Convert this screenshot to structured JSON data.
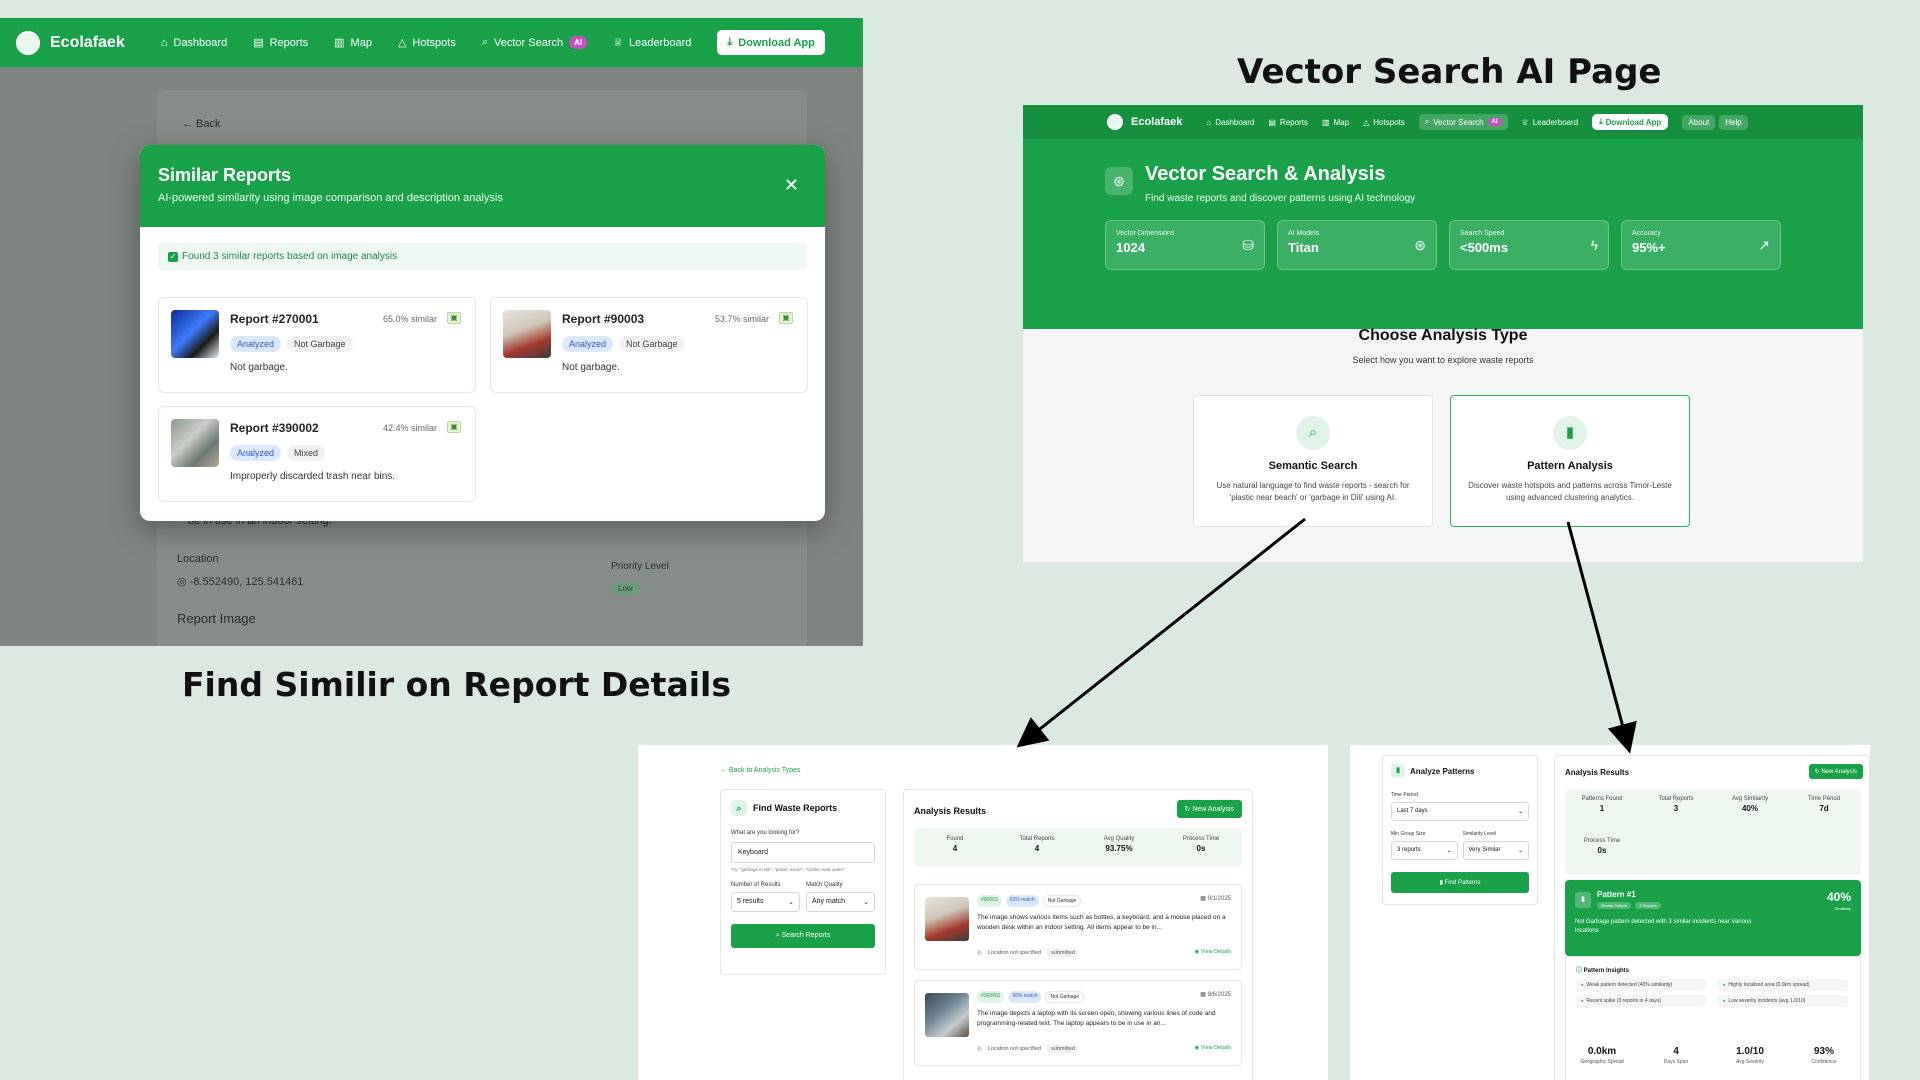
{
  "headings": {
    "vector": "Vector Search AI Page",
    "similar": "Find Similir on Report Details"
  },
  "colors": {
    "brand": "#19a14a",
    "ai_badge": "#c850c0",
    "background": "#dce9e1"
  },
  "p1": {
    "brand": "Ecolafaek",
    "nav": [
      "Dashboard",
      "Reports",
      "Map",
      "Hotspots",
      "Vector Search",
      "Leaderboard"
    ],
    "ai": "AI",
    "download": "Download App",
    "back": "← Back",
    "bg_text": "be in use in an indoor setting.",
    "location_label": "Location",
    "location_value": "-8.552490, 125.541461",
    "priority_label": "Priority Level",
    "priority_value": "Low",
    "report_image": "Report Image",
    "modal": {
      "title": "Similar Reports",
      "subtitle": "AI-powered similarity using image comparison and description analysis",
      "close": "✕",
      "found": "Found 3 similar reports based on image analysis",
      "reports": [
        {
          "title": "Report #270001",
          "sim": "65.0% similar",
          "status": "Analyzed",
          "type": "Not Garbage",
          "desc": "Not garbage."
        },
        {
          "title": "Report #90003",
          "sim": "53.7% similar",
          "status": "Analyzed",
          "type": "Not Garbage",
          "desc": "Not garbage."
        },
        {
          "title": "Report #390002",
          "sim": "42.4% similar",
          "status": "Analyzed",
          "type": "Mixed",
          "desc": "Improperly discarded trash near bins."
        }
      ]
    }
  },
  "p2": {
    "brand": "Ecolafaek",
    "nav": [
      "Dashboard",
      "Reports",
      "Map",
      "Hotspots",
      "Vector Search",
      "Leaderboard"
    ],
    "ai": "AI",
    "download": "Download App",
    "about": "About",
    "help": "Help",
    "title": "Vector Search & Analysis",
    "subtitle": "Find waste reports and discover patterns using AI technology",
    "stats": [
      {
        "label": "Vector Dimensions",
        "value": "1024",
        "icon": "database-icon"
      },
      {
        "label": "AI Models",
        "value": "Titan",
        "icon": "brain-icon"
      },
      {
        "label": "Search Speed",
        "value": "<500ms",
        "icon": "bolt-icon"
      },
      {
        "label": "Accuracy",
        "value": "95%+",
        "icon": "trend-up-icon"
      }
    ],
    "choose_title": "Choose Analysis Type",
    "choose_sub": "Select how you want to explore waste reports",
    "cards": [
      {
        "title": "Semantic Search",
        "desc": "Use natural language to find waste reports - search for 'plastic near beach' or 'garbage in Dili' using AI."
      },
      {
        "title": "Pattern Analysis",
        "desc": "Discover waste hotspots and patterns across Timor-Leste using advanced clustering analytics."
      }
    ]
  },
  "p3": {
    "back": "← Back to Analysis Types",
    "find_title": "Find Waste Reports",
    "q_label": "What are you looking for?",
    "q_value": "Keyboard",
    "hint": "Try: \"garbage in Dili\", \"plastic waste\", \"bottles near water\"",
    "num_label": "Number of Results",
    "num_value": "5 results",
    "match_label": "Match Quality",
    "match_value": "Any match",
    "search_btn": "Search Reports",
    "results_title": "Analysis Results",
    "new_btn": "New Analysis",
    "stats": [
      {
        "label": "Found",
        "value": "4"
      },
      {
        "label": "Total Reports",
        "value": "4"
      },
      {
        "label": "Avg Quality",
        "value": "93.75%"
      },
      {
        "label": "Process Time",
        "value": "0s"
      }
    ],
    "results": [
      {
        "id": "#90003",
        "match": "63% match",
        "type": "Not Garbage",
        "date": "9/1/2025",
        "text": "The image shows various items such as bottles, a keyboard, and a mouse placed on a wooden desk within an indoor setting. All items appear to be in...",
        "loc": "Location not specified",
        "status": "submitted",
        "view": "View Details"
      },
      {
        "id": "#360001",
        "match": "66% match",
        "type": "Not Garbage",
        "date": "9/6/2025",
        "text": "The image depicts a laptop with its screen open, showing various lines of code and programming-related text. The laptop appears to be in use in an...",
        "loc": "Location not specified",
        "status": "submitted",
        "view": "View Details"
      }
    ]
  },
  "p4": {
    "title": "Analyze Patterns",
    "time_label": "Time Period",
    "time_value": "Last 7 days",
    "group_label": "Min Group Size",
    "group_value": "3 reports",
    "level_label": "Similarity Level",
    "level_value": "Very Similar",
    "find_btn": "Find Patterns",
    "results_title": "Analysis Results",
    "new_btn": "New Analysis",
    "stats": [
      {
        "label": "Patterns Found",
        "value": "1"
      },
      {
        "label": "Total Reports",
        "value": "3"
      },
      {
        "label": "Avg Similarity",
        "value": "40%"
      },
      {
        "label": "Time Period",
        "value": "7d"
      }
    ],
    "process_label": "Process Time",
    "process_value": "0s",
    "pattern_title": "Pattern #1",
    "pattern_chip1": "Similar Pattern",
    "pattern_chip2": "3 Reports",
    "pattern_pct": "40%",
    "pattern_pct_label": "Similarity",
    "pattern_desc": "Not Garbage pattern detected with 3 similar incidents near Various locations",
    "insights_title": "Pattern Insights",
    "insights": [
      "Weak pattern detected (40% similarity)",
      "Highly localized area (0.0km spread)",
      "Recent spike (3 reports in 4 days)",
      "Low severity incidents (avg 1.0/10)"
    ],
    "bottom": [
      {
        "value": "0.0km",
        "label": "Geographic Spread"
      },
      {
        "value": "4",
        "label": "Days Span"
      },
      {
        "value": "1.0/10",
        "label": "Avg Severity"
      },
      {
        "value": "93%",
        "label": "Confidence"
      }
    ]
  }
}
